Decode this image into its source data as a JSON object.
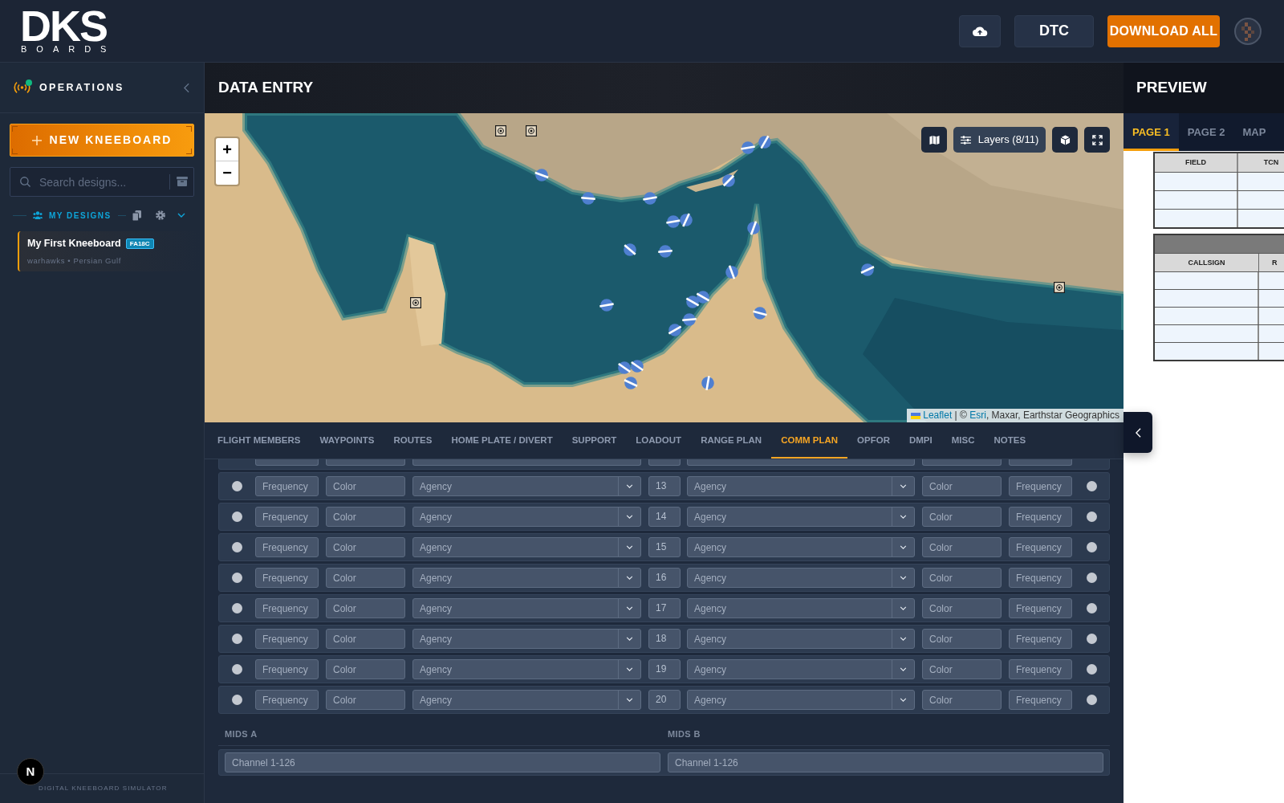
{
  "header": {
    "logo": {
      "mark": "DKS",
      "wordmark": "BOARDS"
    },
    "dtc_button": "DTC",
    "download_button": "DOWNLOAD ALL"
  },
  "sidebar": {
    "title": "OPERATIONS",
    "connected": true,
    "new_button": "NEW KNEEBOARD",
    "search": {
      "placeholder": "Search designs..."
    },
    "section": {
      "title": "MY DESIGNS",
      "expanded": true
    },
    "designs": [
      {
        "name": "My First Kneeboard",
        "badge": "FA18C",
        "meta": "warhawks • Persian Gulf",
        "selected": true
      }
    ],
    "footer": "DIGITAL KNEEBOARD SIMULATOR"
  },
  "data_entry": {
    "title": "DATA ENTRY",
    "map": {
      "zoom_in": "+",
      "zoom_out": "−",
      "layers_button": "Layers (8/11)",
      "attribution": [
        {
          "text": "Leaflet",
          "kind": "link"
        },
        {
          "text": " | © ",
          "kind": "text"
        },
        {
          "text": "Esri",
          "kind": "link"
        },
        {
          "text": ", Maxar, Earthstar Geographics",
          "kind": "text"
        }
      ]
    },
    "tabs": [
      {
        "label": "FLIGHT MEMBERS",
        "selected": false
      },
      {
        "label": "WAYPOINTS",
        "selected": false
      },
      {
        "label": "ROUTES",
        "selected": false
      },
      {
        "label": "HOME PLATE / DIVERT",
        "selected": false
      },
      {
        "label": "SUPPORT",
        "selected": false
      },
      {
        "label": "LOADOUT",
        "selected": false
      },
      {
        "label": "RANGE PLAN",
        "selected": false
      },
      {
        "label": "COMM PLAN",
        "selected": true
      },
      {
        "label": "OPFOR",
        "selected": false
      },
      {
        "label": "DMPI",
        "selected": false
      },
      {
        "label": "MISC",
        "selected": false
      },
      {
        "label": "NOTES",
        "selected": false
      }
    ],
    "comm_rows": [
      {
        "left_selected": false,
        "left_frequency": {
          "placeholder": "Frequency"
        },
        "left_color": {
          "placeholder": "Color"
        },
        "left_agency": {
          "placeholder": "Agency"
        },
        "channel": "13",
        "right_agency": {
          "placeholder": "Agency"
        },
        "right_color": {
          "placeholder": "Color"
        },
        "right_frequency": {
          "placeholder": "Frequency"
        },
        "right_selected": false
      },
      {
        "left_selected": false,
        "left_frequency": {
          "placeholder": "Frequency"
        },
        "left_color": {
          "placeholder": "Color"
        },
        "left_agency": {
          "placeholder": "Agency"
        },
        "channel": "14",
        "right_agency": {
          "placeholder": "Agency"
        },
        "right_color": {
          "placeholder": "Color"
        },
        "right_frequency": {
          "placeholder": "Frequency"
        },
        "right_selected": false
      },
      {
        "left_selected": false,
        "left_frequency": {
          "placeholder": "Frequency"
        },
        "left_color": {
          "placeholder": "Color"
        },
        "left_agency": {
          "placeholder": "Agency"
        },
        "channel": "15",
        "right_agency": {
          "placeholder": "Agency"
        },
        "right_color": {
          "placeholder": "Color"
        },
        "right_frequency": {
          "placeholder": "Frequency"
        },
        "right_selected": false
      },
      {
        "left_selected": false,
        "left_frequency": {
          "placeholder": "Frequency"
        },
        "left_color": {
          "placeholder": "Color"
        },
        "left_agency": {
          "placeholder": "Agency"
        },
        "channel": "16",
        "right_agency": {
          "placeholder": "Agency"
        },
        "right_color": {
          "placeholder": "Color"
        },
        "right_frequency": {
          "placeholder": "Frequency"
        },
        "right_selected": false
      },
      {
        "left_selected": false,
        "left_frequency": {
          "placeholder": "Frequency"
        },
        "left_color": {
          "placeholder": "Color"
        },
        "left_agency": {
          "placeholder": "Agency"
        },
        "channel": "17",
        "right_agency": {
          "placeholder": "Agency"
        },
        "right_color": {
          "placeholder": "Color"
        },
        "right_frequency": {
          "placeholder": "Frequency"
        },
        "right_selected": false
      },
      {
        "left_selected": false,
        "left_frequency": {
          "placeholder": "Frequency"
        },
        "left_color": {
          "placeholder": "Color"
        },
        "left_agency": {
          "placeholder": "Agency"
        },
        "channel": "18",
        "right_agency": {
          "placeholder": "Agency"
        },
        "right_color": {
          "placeholder": "Color"
        },
        "right_frequency": {
          "placeholder": "Frequency"
        },
        "right_selected": false
      },
      {
        "left_selected": false,
        "left_frequency": {
          "placeholder": "Frequency"
        },
        "left_color": {
          "placeholder": "Color"
        },
        "left_agency": {
          "placeholder": "Agency"
        },
        "channel": "19",
        "right_agency": {
          "placeholder": "Agency"
        },
        "right_color": {
          "placeholder": "Color"
        },
        "right_frequency": {
          "placeholder": "Frequency"
        },
        "right_selected": false
      },
      {
        "left_selected": false,
        "left_frequency": {
          "placeholder": "Frequency"
        },
        "left_color": {
          "placeholder": "Color"
        },
        "left_agency": {
          "placeholder": "Agency"
        },
        "channel": "20",
        "right_agency": {
          "placeholder": "Agency"
        },
        "right_color": {
          "placeholder": "Color"
        },
        "right_frequency": {
          "placeholder": "Frequency"
        },
        "right_selected": false
      }
    ],
    "mids": [
      {
        "label": "MIDS A",
        "placeholder": "Channel 1-126"
      },
      {
        "label": "MIDS B",
        "placeholder": "Channel 1-126"
      }
    ]
  },
  "preview": {
    "title": "PREVIEW",
    "tabs": [
      {
        "label": "PAGE 1",
        "selected": true
      },
      {
        "label": "PAGE 2",
        "selected": false
      },
      {
        "label": "MAP",
        "selected": false
      }
    ],
    "tables": [
      {
        "columns": [
          "FIELD",
          "TCN"
        ]
      },
      {
        "columns": [
          "CALLSIGN",
          "R"
        ]
      }
    ]
  },
  "dev_button": "N"
}
